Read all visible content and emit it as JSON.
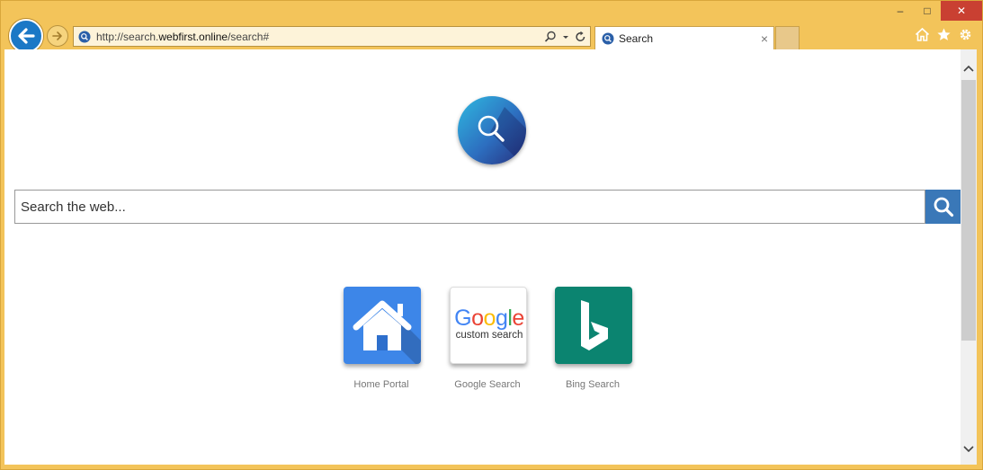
{
  "browser": {
    "address_bar": {
      "url_prefix": "http://search.",
      "url_domain": "webfirst.online",
      "url_suffix": "/search#"
    },
    "tab": {
      "title": "Search",
      "close": "×"
    },
    "window_controls": {
      "minimize": "–",
      "maximize": "□",
      "close": "✕"
    }
  },
  "page": {
    "search": {
      "placeholder": "Search the web..."
    },
    "tiles": [
      {
        "label": "Home Portal"
      },
      {
        "label": "Google Search",
        "logo_word": "Google",
        "logo_sub": "custom search"
      },
      {
        "label": "Bing Search"
      }
    ]
  },
  "colors": {
    "frame": "#f3c45a",
    "back_button": "#1b78c6",
    "search_button": "#3a78b8",
    "home_tile": "#3d86e8",
    "bing_tile": "#0b8470"
  }
}
